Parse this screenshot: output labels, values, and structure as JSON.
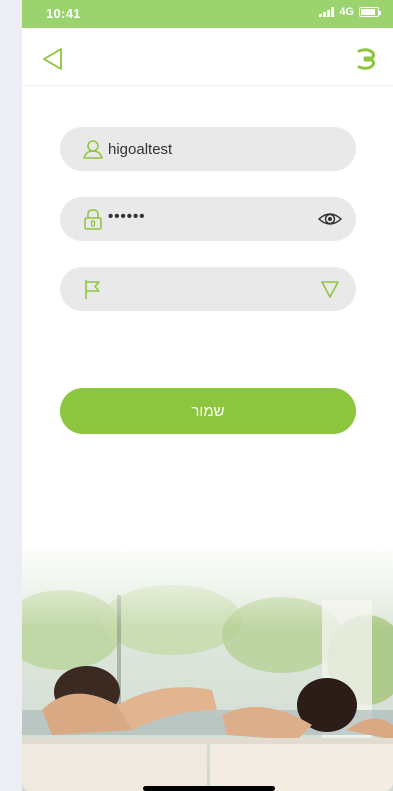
{
  "status_bar": {
    "time": "10:41",
    "network": "4G"
  },
  "nav": {
    "back_icon": "back-triangle-icon",
    "logo_icon": "brand-logo-icon"
  },
  "form": {
    "username": {
      "icon": "user-icon",
      "value": "higoaltest"
    },
    "password": {
      "icon": "lock-icon",
      "value": "••••••",
      "toggle_icon": "eye-icon"
    },
    "country": {
      "icon": "flag-icon",
      "value": "",
      "dropdown_icon": "triangle-down-icon"
    },
    "save_label": "שמור"
  },
  "colors": {
    "accent": "#8cc63f",
    "status_bar": "#9bd46f",
    "field_bg": "#e9e9e9"
  }
}
